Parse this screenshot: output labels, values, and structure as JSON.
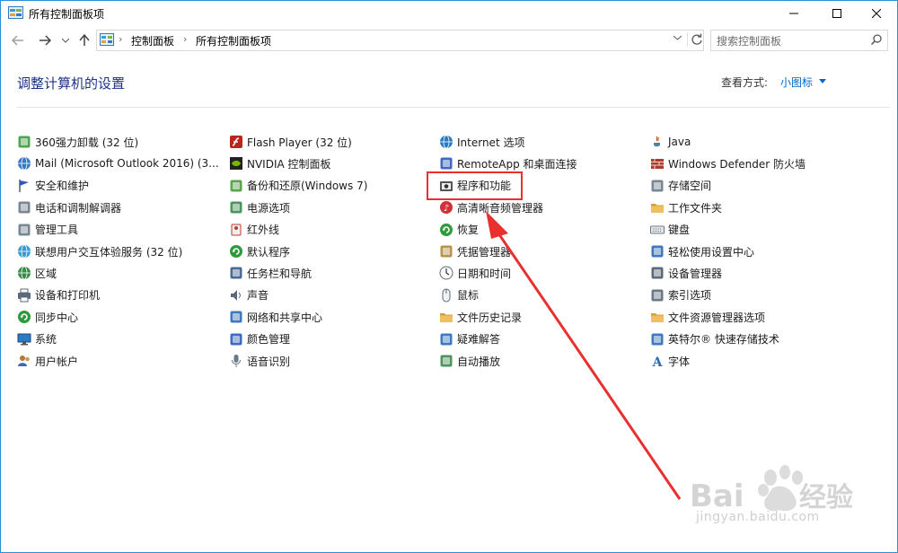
{
  "window": {
    "title": "所有控制面板项"
  },
  "nav": {
    "breadcrumb": [
      "控制面板",
      "所有控制面板项"
    ],
    "search_placeholder": "搜索控制面板"
  },
  "header": {
    "title": "调整计算机的设置",
    "view_label": "查看方式:",
    "view_value": "小图标"
  },
  "columns": [
    [
      {
        "label": "360强力卸载 (32 位)",
        "icon": "uninstall-icon",
        "color": "#3c9b3c"
      },
      {
        "label": "Mail (Microsoft Outlook 2016) (3...",
        "icon": "mail-icon",
        "color": "#3a78c2"
      },
      {
        "label": "安全和维护",
        "icon": "flag-icon",
        "color": "#2a58b8"
      },
      {
        "label": "电话和调制解调器",
        "icon": "modem-icon",
        "color": "#6a7a8a"
      },
      {
        "label": "管理工具",
        "icon": "admin-tools-icon",
        "color": "#6a7a8a"
      },
      {
        "label": "联想用户交互体验服务 (32 位)",
        "icon": "lenovo-icon",
        "color": "#3a9bd0"
      },
      {
        "label": "区域",
        "icon": "globe-icon",
        "color": "#3a8a4a"
      },
      {
        "label": "设备和打印机",
        "icon": "printer-icon",
        "color": "#5a6a7a"
      },
      {
        "label": "同步中心",
        "icon": "sync-icon",
        "color": "#2e9a3e"
      },
      {
        "label": "系统",
        "icon": "monitor-icon",
        "color": "#2a7ac2"
      },
      {
        "label": "用户帐户",
        "icon": "users-icon",
        "color": "#b07a3a"
      }
    ],
    [
      {
        "label": "Flash Player (32 位)",
        "icon": "flash-icon",
        "color": "#b8261e"
      },
      {
        "label": "NVIDIA 控制面板",
        "icon": "nvidia-icon",
        "color": "#76b900"
      },
      {
        "label": "备份和还原(Windows 7)",
        "icon": "backup-icon",
        "color": "#4a9a3a"
      },
      {
        "label": "电源选项",
        "icon": "power-icon",
        "color": "#3a8a4a"
      },
      {
        "label": "红外线",
        "icon": "infrared-icon",
        "color": "#c23a2a"
      },
      {
        "label": "默认程序",
        "icon": "default-programs-icon",
        "color": "#2e9a3e"
      },
      {
        "label": "任务栏和导航",
        "icon": "taskbar-icon",
        "color": "#3a5a8a"
      },
      {
        "label": "声音",
        "icon": "speaker-icon",
        "color": "#5a6a7a"
      },
      {
        "label": "网络和共享中心",
        "icon": "network-icon",
        "color": "#2a6ab8"
      },
      {
        "label": "颜色管理",
        "icon": "color-management-icon",
        "color": "#2a5ab8"
      },
      {
        "label": "语音识别",
        "icon": "microphone-icon",
        "color": "#6a7a8a"
      }
    ],
    [
      {
        "label": "Internet 选项",
        "icon": "internet-icon",
        "color": "#2a7ac2"
      },
      {
        "label": "RemoteApp 和桌面连接",
        "icon": "remoteapp-icon",
        "color": "#2a5ab8"
      },
      {
        "label": "程序和功能",
        "icon": "programs-icon",
        "color": "#4a4a4a"
      },
      {
        "label": "高清晰音频管理器",
        "icon": "audio-manager-icon",
        "color": "#d0323a"
      },
      {
        "label": "恢复",
        "icon": "recovery-icon",
        "color": "#2e9a3e"
      },
      {
        "label": "凭据管理器",
        "icon": "credential-icon",
        "color": "#b08a3a"
      },
      {
        "label": "日期和时间",
        "icon": "clock-icon",
        "color": "#5a6a7a"
      },
      {
        "label": "鼠标",
        "icon": "mouse-icon",
        "color": "#5a6a7a"
      },
      {
        "label": "文件历史记录",
        "icon": "file-history-icon",
        "color": "#d0a23a"
      },
      {
        "label": "疑难解答",
        "icon": "troubleshoot-icon",
        "color": "#2a6ab8"
      },
      {
        "label": "自动播放",
        "icon": "autoplay-icon",
        "color": "#3a8a4a"
      }
    ],
    [
      {
        "label": "Java",
        "icon": "java-icon",
        "color": "#c2602a"
      },
      {
        "label": "Windows Defender 防火墙",
        "icon": "firewall-icon",
        "color": "#b03a2a"
      },
      {
        "label": "存储空间",
        "icon": "storage-icon",
        "color": "#6a7a8a"
      },
      {
        "label": "工作文件夹",
        "icon": "work-folders-icon",
        "color": "#d0a23a"
      },
      {
        "label": "键盘",
        "icon": "keyboard-icon",
        "color": "#6a7a8a"
      },
      {
        "label": "轻松使用设置中心",
        "icon": "ease-of-access-icon",
        "color": "#2a6ab8"
      },
      {
        "label": "设备管理器",
        "icon": "device-manager-icon",
        "color": "#4a5a6a"
      },
      {
        "label": "索引选项",
        "icon": "indexing-icon",
        "color": "#5a6a7a"
      },
      {
        "label": "文件资源管理器选项",
        "icon": "explorer-options-icon",
        "color": "#d0a23a"
      },
      {
        "label": "英特尔® 快速存储技术",
        "icon": "intel-rst-icon",
        "color": "#2a6ab8"
      },
      {
        "label": "字体",
        "icon": "fonts-icon",
        "color": "#d0a23a"
      }
    ]
  ],
  "annotation": {
    "highlighted_item": "程序和功能",
    "arrow_color": "#e8302f"
  },
  "watermark": {
    "brand": "Baidu 经验",
    "url": "jingyan.baidu.com"
  }
}
